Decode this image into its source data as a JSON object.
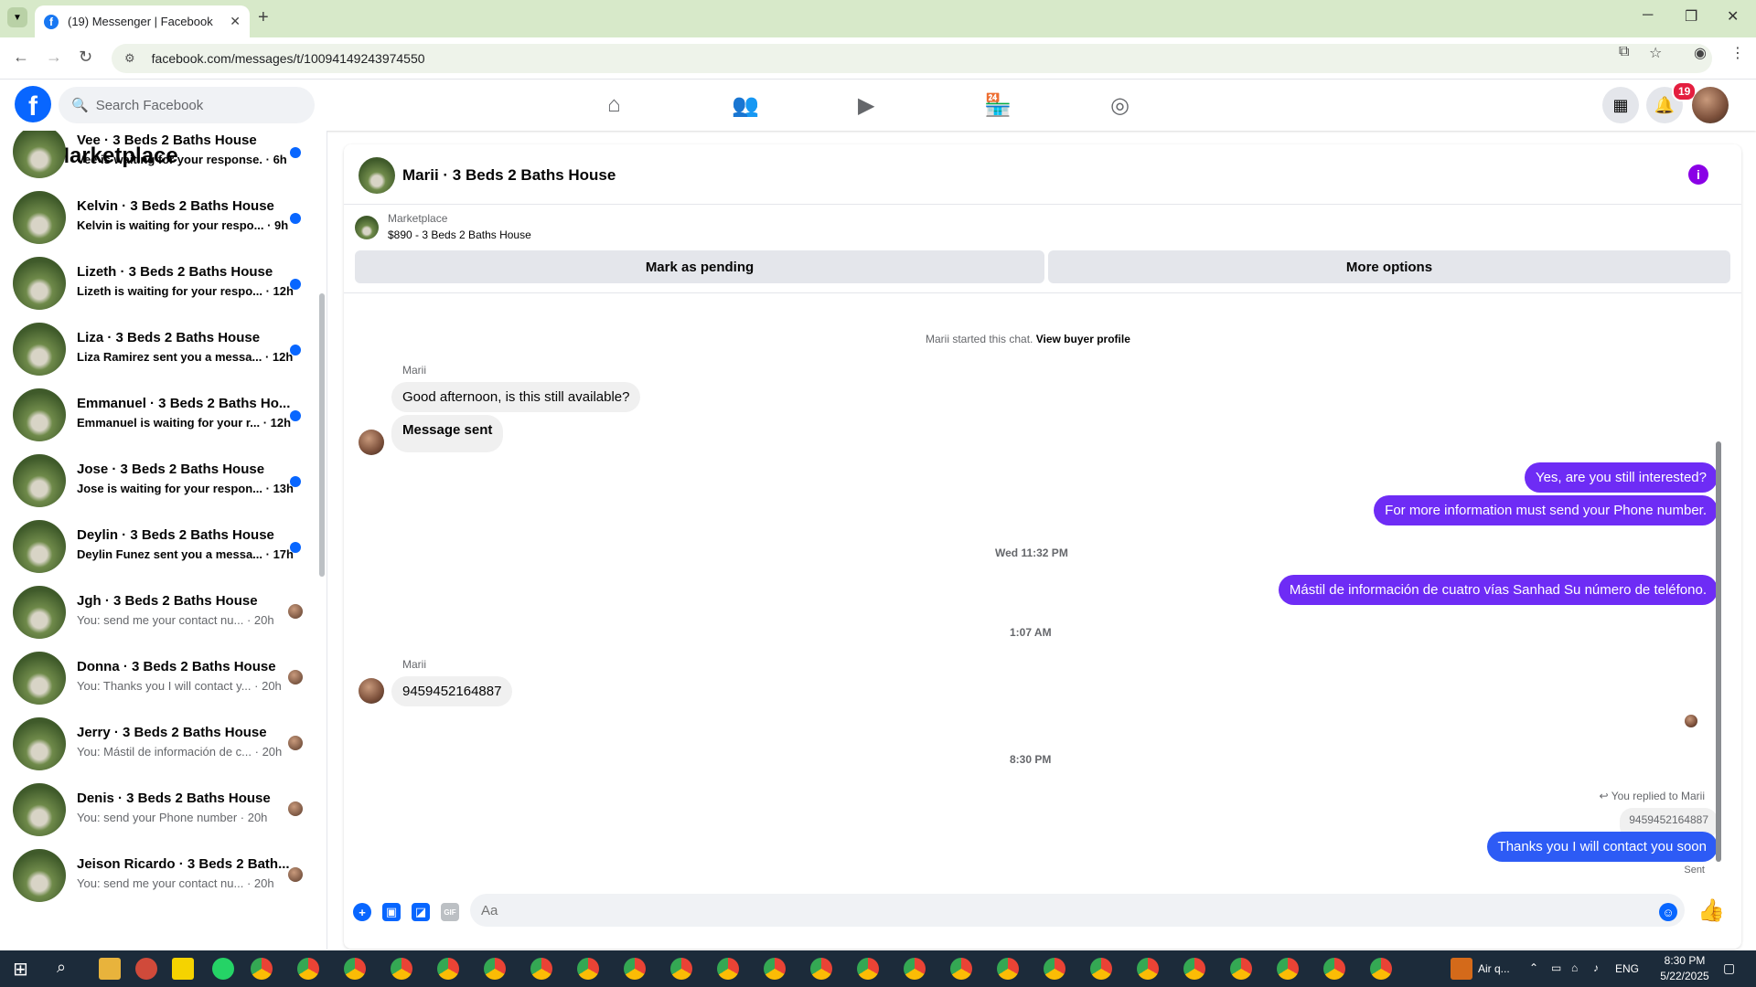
{
  "browser": {
    "tab_title": "(19) Messenger | Facebook",
    "url": "facebook.com/messages/t/10094149243974550"
  },
  "fb_header": {
    "search_placeholder": "Search Facebook",
    "notification_count": "19"
  },
  "left_panel": {
    "title": "Marketplace",
    "conversations": [
      {
        "name": "Vee · 3 Beds 2 Baths House",
        "preview": "Vee is waiting for your response.",
        "time": "· 6h",
        "unread": true
      },
      {
        "name": "Kelvin · 3 Beds 2 Baths House",
        "preview": "Kelvin is waiting for your respo...",
        "time": "· 9h",
        "unread": true
      },
      {
        "name": "Lizeth · 3 Beds 2 Baths House",
        "preview": "Lizeth is waiting for your respo...",
        "time": "· 12h",
        "unread": true
      },
      {
        "name": "Liza · 3 Beds 2 Baths House",
        "preview": "Liza Ramirez sent you a messa...",
        "time": "· 12h",
        "unread": true
      },
      {
        "name": "Emmanuel · 3 Beds 2 Baths Ho...",
        "preview": "Emmanuel is waiting for your r...",
        "time": "· 12h",
        "unread": true
      },
      {
        "name": "Jose · 3 Beds 2 Baths House",
        "preview": "Jose is waiting for your respon...",
        "time": "· 13h",
        "unread": true
      },
      {
        "name": "Deylin · 3 Beds 2 Baths House",
        "preview": "Deylin Funez sent you a messa...",
        "time": "· 17h",
        "unread": true
      },
      {
        "name": "Jgh · 3 Beds 2 Baths House",
        "preview": "You: send me your contact nu...",
        "time": "· 20h",
        "unread": false
      },
      {
        "name": "Donna · 3 Beds 2 Baths House",
        "preview": "You: Thanks you I will contact y...",
        "time": "· 20h",
        "unread": false
      },
      {
        "name": "Jerry · 3 Beds 2 Baths House",
        "preview": "You: Mástil de información de c...",
        "time": "· 20h",
        "unread": false
      },
      {
        "name": "Denis · 3 Beds 2 Baths House",
        "preview": "You: send your Phone number",
        "time": "· 20h",
        "unread": false
      },
      {
        "name": "Jeison Ricardo · 3 Beds 2 Bath...",
        "preview": "You: send me your contact nu...",
        "time": "· 20h",
        "unread": false
      }
    ]
  },
  "chat": {
    "title": "Marii · 3 Beds 2 Baths House",
    "marketplace_label": "Marketplace",
    "listing": "$890 - 3 Beds 2 Baths House",
    "mark_pending": "Mark as pending",
    "more_options": "More options",
    "started_text": "Marii started this chat.",
    "view_profile": "View buyer profile",
    "sender_name": "Marii",
    "msg_in_1": "Good afternoon, is this still available?",
    "msg_in_2": "Message sent",
    "msg_out_1": "Yes, are you still interested?",
    "msg_out_2": "For more information must send your Phone number.",
    "time_1": "Wed 11:32 PM",
    "msg_out_3": "Mástil de información de cuatro vías Sanhad Su número de teléfono.",
    "time_2": "1:07 AM",
    "msg_in_3": "9459452164887",
    "time_3": "8:30 PM",
    "replied_to": "You replied to Marii",
    "quoted": "9459452164887",
    "msg_out_4": "Thanks you I will contact you soon",
    "status": "Sent",
    "composer_placeholder": "Aa"
  },
  "taskbar": {
    "app_label": "Air q...",
    "lang": "ENG",
    "time": "8:30 PM",
    "date": "5/22/2025"
  },
  "colors": {
    "fb_blue": "#0866ff",
    "purple_bubble": "#6e2cf5",
    "blue_bubble": "#2d5bf5",
    "unread_dot": "#0866ff"
  }
}
